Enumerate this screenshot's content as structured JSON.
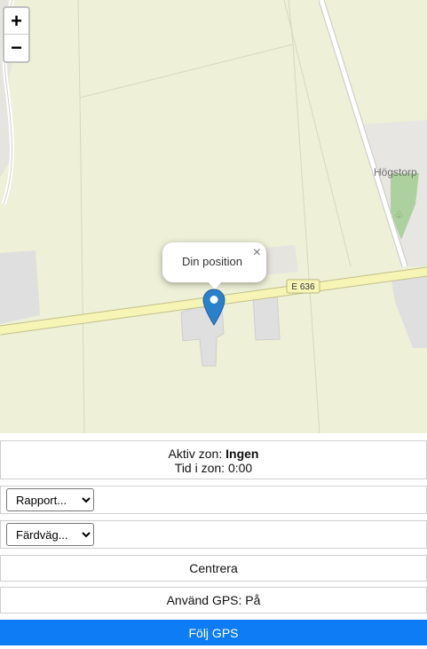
{
  "map": {
    "road_label": "E 636",
    "place_label": "Högstorp",
    "zoom_in": "+",
    "zoom_out": "−",
    "popup_text": "Din position",
    "popup_close": "×",
    "colors": {
      "fields": "#eef0d7",
      "road": "#f6f5b6",
      "building": "#e0dfdf",
      "park": "#add19e"
    }
  },
  "zone": {
    "active_label": "Aktiv zon:",
    "active_value": "Ingen",
    "time_text": "Tid i zon: 0:00"
  },
  "report_select": {
    "selected": "Rapport..."
  },
  "route_select": {
    "selected": "Färdväg..."
  },
  "buttons": {
    "center": "Centrera",
    "use_gps": "Använd GPS: På",
    "follow_gps": "Följ GPS"
  }
}
